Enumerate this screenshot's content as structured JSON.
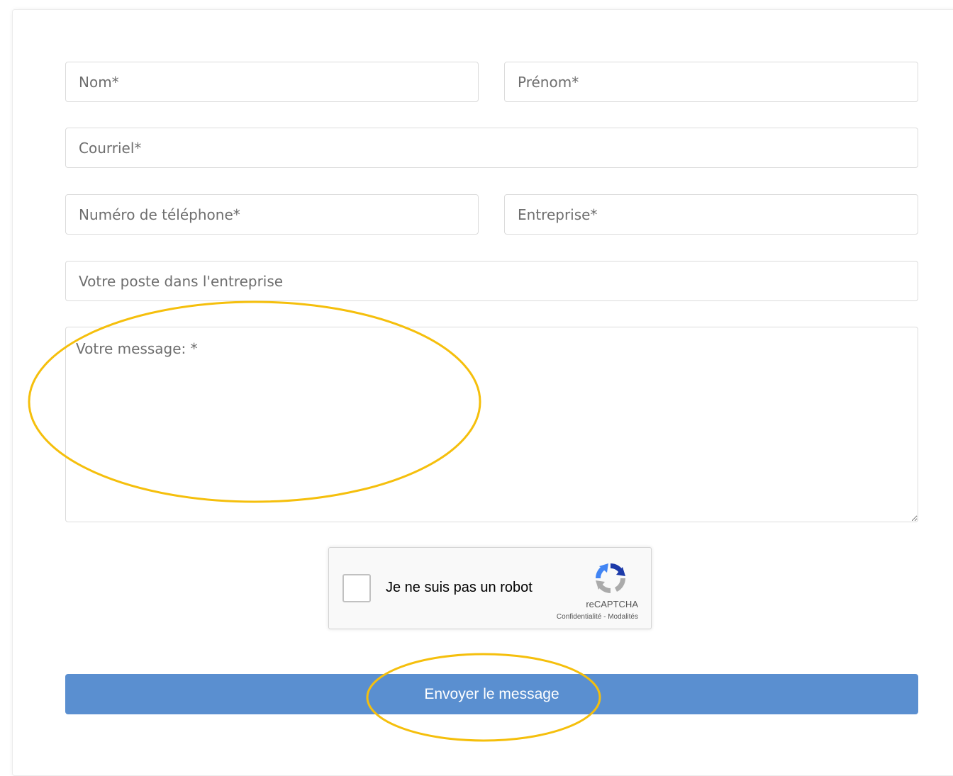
{
  "form": {
    "nom_placeholder": "Nom*",
    "prenom_placeholder": "Prénom*",
    "courriel_placeholder": "Courriel*",
    "telephone_placeholder": "Numéro de téléphone*",
    "entreprise_placeholder": "Entreprise*",
    "poste_placeholder": "Votre poste dans l'entreprise",
    "message_placeholder": "Votre message: *"
  },
  "recaptcha": {
    "label": "Je ne suis pas un robot",
    "brand": "reCAPTCHA",
    "privacy_link": "Confidentialité",
    "separator": " - ",
    "terms_link": "Modalités",
    "logo_icon": "recaptcha-logo-icon"
  },
  "submit": {
    "label": "Envoyer le message",
    "color": "#5a8fd0"
  },
  "annotations": {
    "highlight_color": "#f5bf0c"
  }
}
